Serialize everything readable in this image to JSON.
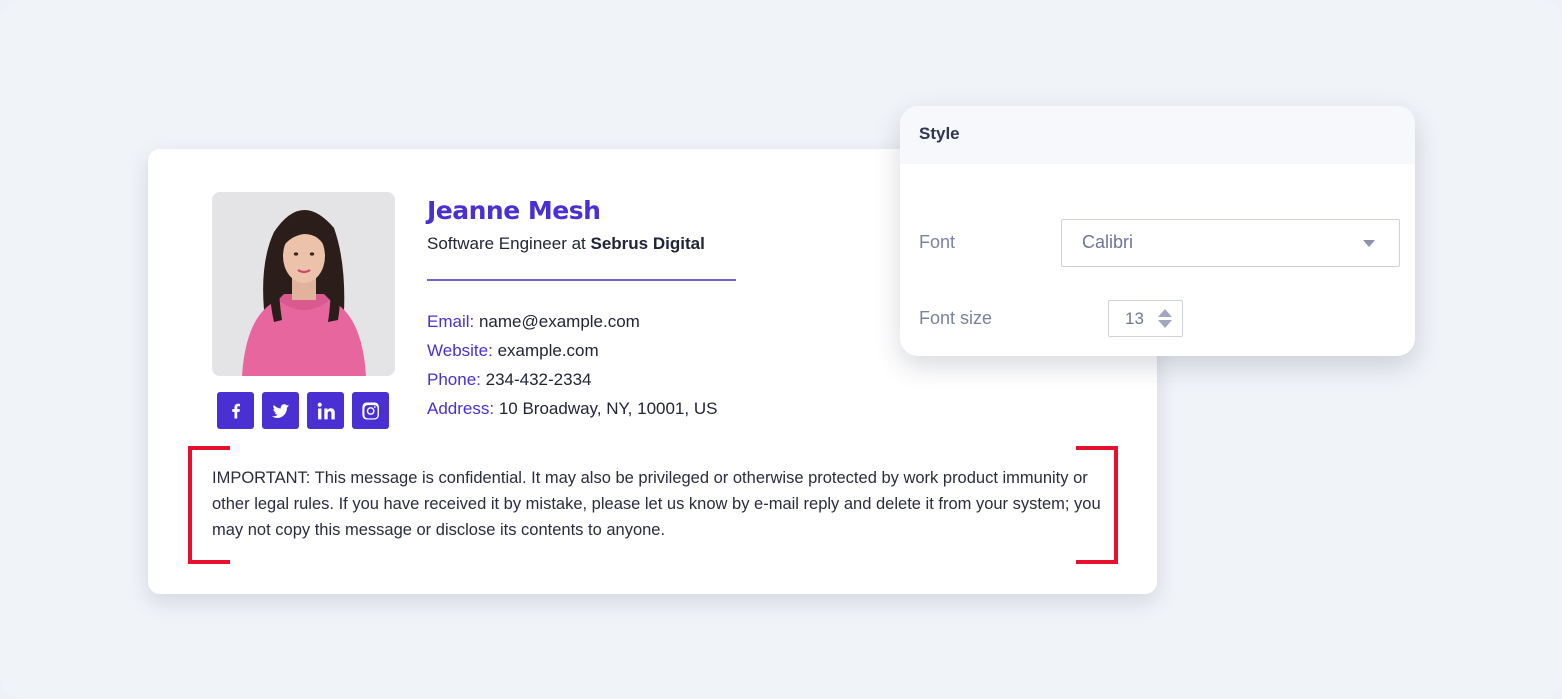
{
  "signature": {
    "name": "Jeanne Mesh",
    "job_prefix": "Software Engineer at ",
    "company": "Sebrus Digital",
    "contact": [
      {
        "label": "Email:",
        "value": "name@example.com"
      },
      {
        "label": "Website:",
        "value": "example.com"
      },
      {
        "label": "Phone:",
        "value": "234-432-2334"
      },
      {
        "label": "Address:",
        "value": "10 Broadway, NY, 10001, US"
      }
    ],
    "socials": [
      "facebook-icon",
      "twitter-icon",
      "linkedin-icon",
      "instagram-icon"
    ],
    "disclaimer": "IMPORTANT: This message is confidential. It may also be privileged or otherwise protected by work product immunity or other legal rules. If you have received it by mistake, please let us know by e-mail reply and delete it from your system; you may not copy this message or disclose its contents to anyone."
  },
  "style_panel": {
    "title": "Style",
    "font_label": "Font",
    "font_value": "Calibri",
    "font_size_label": "Font size",
    "font_size_value": "13"
  },
  "colors": {
    "accent": "#4a2fd3",
    "bracket": "#e8102d",
    "background": "#f0f3f8"
  }
}
